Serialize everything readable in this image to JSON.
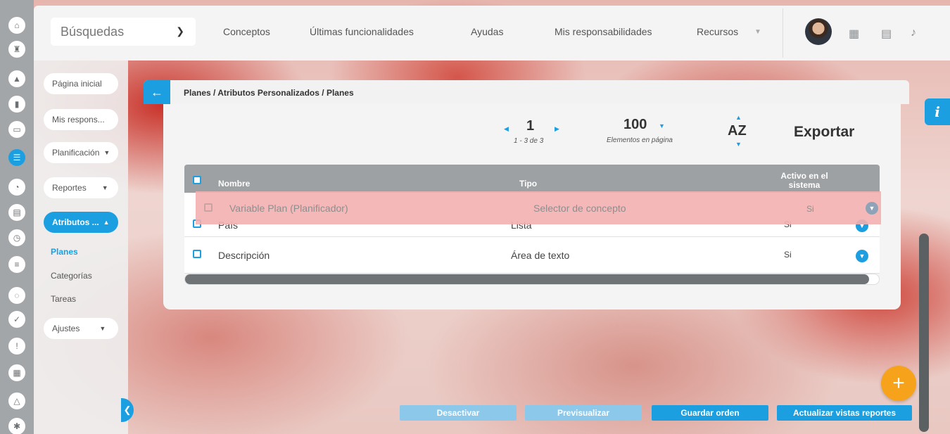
{
  "rail": {
    "icons": [
      "home-icon",
      "tower-icon",
      "alert-icon",
      "chart-icon",
      "presentation-icon",
      "planner-icon",
      "pie-icon",
      "folder-icon",
      "clock-icon",
      "document-icon",
      "cycle-icon",
      "check-icon",
      "warning-icon",
      "calendar-icon",
      "network-icon",
      "gear-icon"
    ]
  },
  "topbar": {
    "search_label": "Búsquedas",
    "nav": [
      "Conceptos",
      "Últimas funcionalidades",
      "Ayudas",
      "Mis responsabilidades",
      "Recursos"
    ]
  },
  "sidebar": {
    "items": [
      {
        "label": "Página inicial"
      },
      {
        "label": "Mis respons..."
      },
      {
        "label": "Planificación"
      },
      {
        "label": "Reportes"
      },
      {
        "label": "Atributos ..."
      },
      {
        "label": "Ajustes"
      }
    ],
    "sublinks": [
      "Planes",
      "Categorías",
      "Tareas"
    ]
  },
  "main": {
    "breadcrumb": "Planes / Atributos Personalizados / Planes",
    "pager": {
      "page": "1",
      "range": "1 - 3 de 3",
      "per_page": "100",
      "per_page_label": "Elementos en página",
      "sort": "AZ",
      "export": "Exportar"
    },
    "table": {
      "headers": [
        "Nombre",
        "Tipo",
        "Activo en el sistema"
      ],
      "dragging_row": {
        "name": "Variable Plan (Planificador)",
        "type": "Selector de concepto",
        "active": "Si"
      },
      "rows": [
        {
          "name": "País",
          "type": "Lista",
          "active": "Si"
        },
        {
          "name": "Descripción",
          "type": "Área de texto",
          "active": "Si"
        }
      ]
    }
  },
  "footer": {
    "buttons": [
      "Desactivar",
      "Previsualizar",
      "Guardar orden",
      "Actualizar vistas reportes"
    ]
  },
  "colors": {
    "accent": "#1c9fe0",
    "fab": "#f7a21b"
  }
}
